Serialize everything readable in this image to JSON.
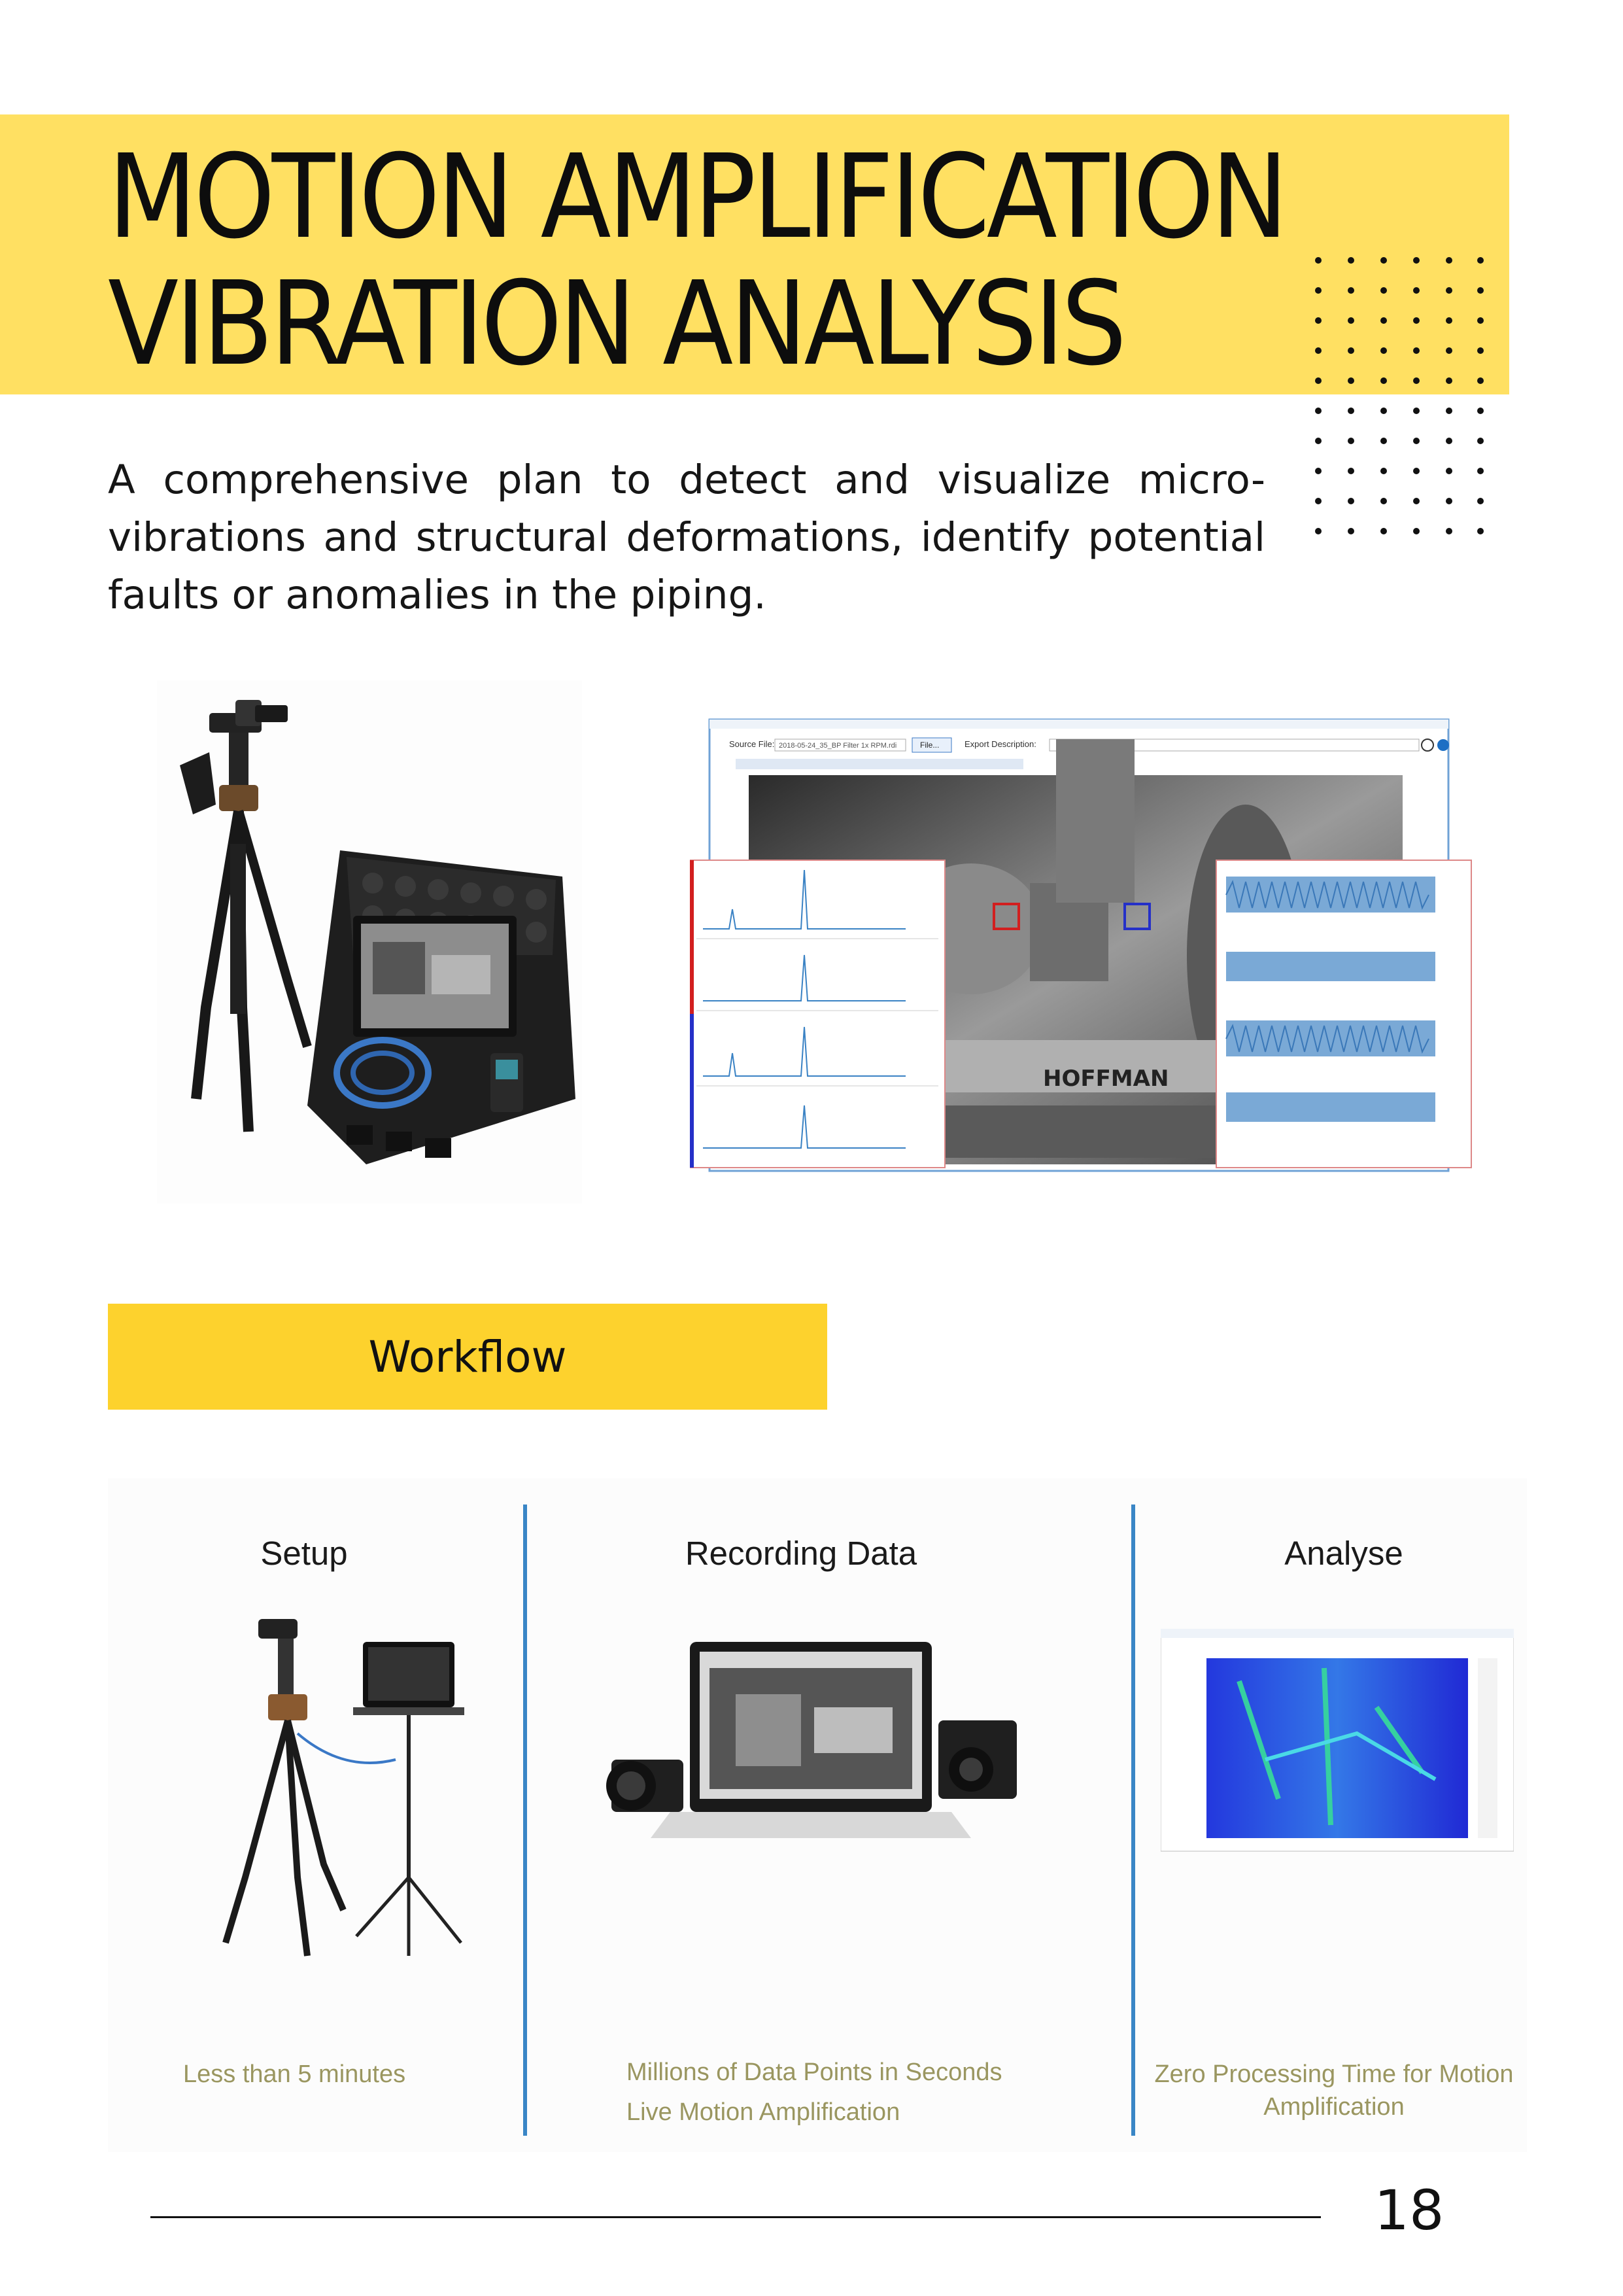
{
  "title": {
    "line1": "MOTION AMPLIFICATION",
    "line2": "VIBRATION ANALYSIS"
  },
  "intro": "A comprehensive plan to detect and visualize micro-vibrations and structural deformations, identify potential faults or anomalies in the piping.",
  "software_screenshot": {
    "source_file_label": "Source File:",
    "source_file_value": "2018-05-24_35_BP Filter 1x RPM.rdi",
    "file_button": "File...",
    "export_label": "Export Description:",
    "equipment_label": "HOFFMAN"
  },
  "workflow": {
    "heading": "Workflow",
    "steps": [
      {
        "title": "Setup",
        "captions": [
          "Less than 5 minutes"
        ]
      },
      {
        "title": "Recording Data",
        "captions": [
          "Millions of Data Points in Seconds",
          "Live Motion Amplification"
        ]
      },
      {
        "title": "Analyse",
        "captions": [
          "Zero Processing Time for Motion",
          "Amplification"
        ]
      }
    ]
  },
  "page_number": "18",
  "colors": {
    "title_band": "#ffe062",
    "workflow_band": "#fdd22d",
    "divider": "#3a86c6",
    "caption": "#9a9660"
  }
}
